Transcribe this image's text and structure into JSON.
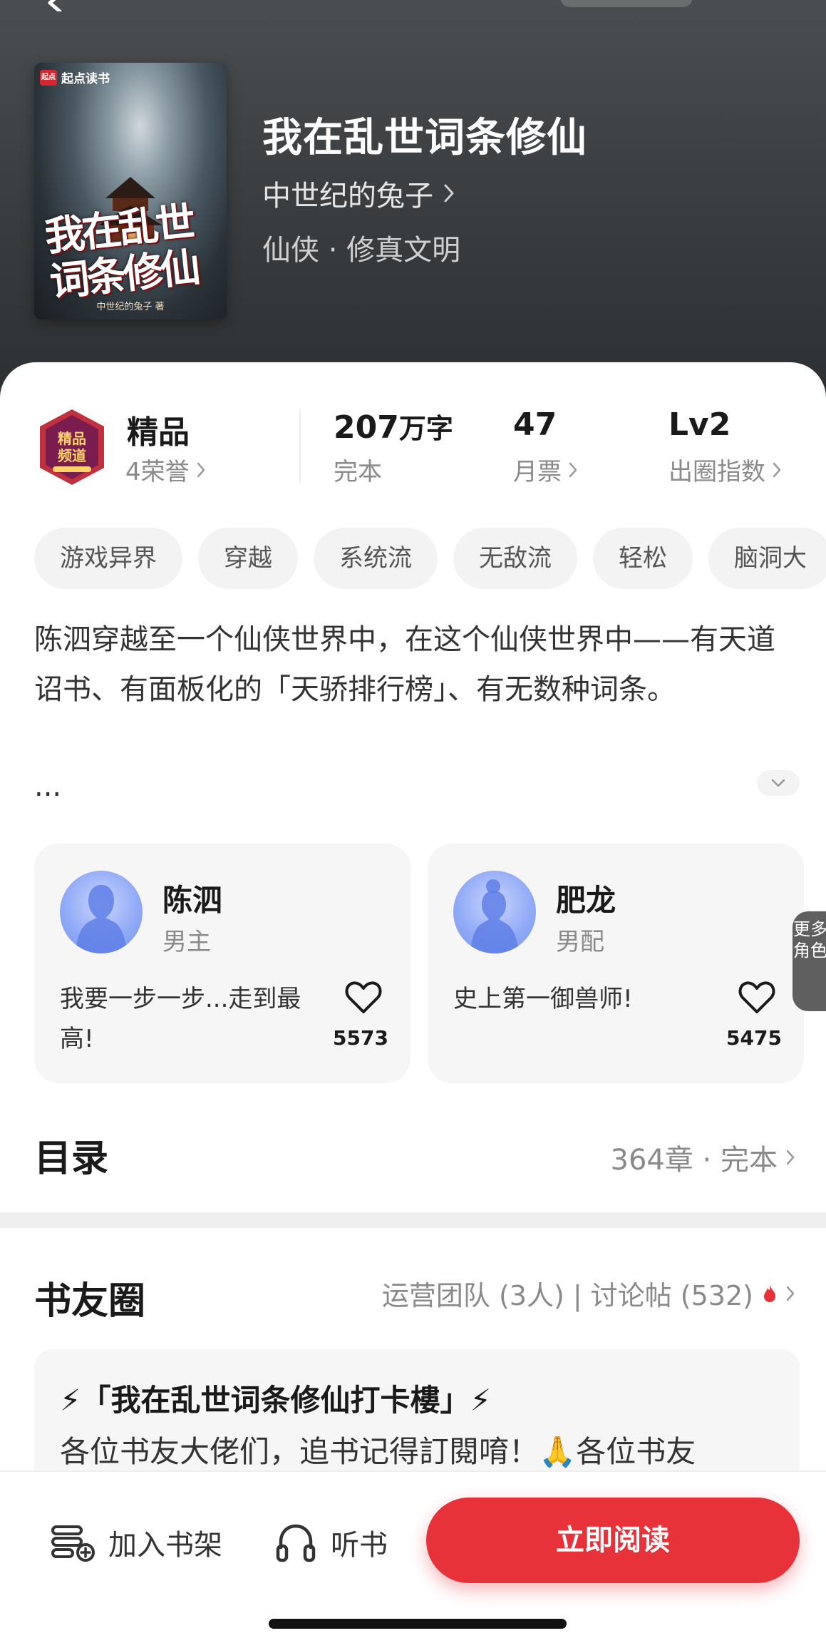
{
  "book": {
    "title": "我在乱世词条修仙",
    "author": "中世纪的兔子",
    "genre": "仙侠 · 修真文明",
    "cover": {
      "brand": "起点读书",
      "title_art": "我在乱世词条修仙",
      "author_mark": "中世纪的兔子 著"
    }
  },
  "stats": {
    "quality": {
      "label": "精品",
      "sub": "4荣誉"
    },
    "words": {
      "value": "207",
      "unit": "万字",
      "sub": "完本"
    },
    "tickets": {
      "value": "47",
      "sub": "月票"
    },
    "level": {
      "value": "Lv2",
      "sub": "出圈指数"
    }
  },
  "tags": [
    "游戏异界",
    "穿越",
    "系统流",
    "无敌流",
    "轻松",
    "脑洞大"
  ],
  "description": {
    "text": "陈泗穿越至一个仙侠世界中，在这个仙侠世界中——有天道诏书、有面板化的「天骄排行榜」、有无数种词条。",
    "ellipsis": "..."
  },
  "characters": [
    {
      "name": "陈泗",
      "role": "男主",
      "quote": "我要一步一步...走到最高!",
      "likes": "5573"
    },
    {
      "name": "肥龙",
      "role": "男配",
      "quote": "史上第一御兽师!",
      "likes": "5475"
    }
  ],
  "more_roles_label": "更多角色",
  "toc": {
    "title": "目录",
    "meta": "364章 · 完本"
  },
  "circle": {
    "title": "书友圈",
    "meta": "运营团队 (3人) | 讨论帖 (532)",
    "post": {
      "title": "⚡「我在乱世词条修仙打卡樓」⚡",
      "body": "各位书友大佬们，追书记得訂閱唷！🙏各位书友"
    }
  },
  "bottom_bar": {
    "add_shelf": "加入书架",
    "listen": "听书",
    "read_now": "立即阅读"
  },
  "colors": {
    "accent": "#e8323a",
    "hero_bg": "#3c3f41",
    "avatar_blue": "#8fa8f6"
  }
}
